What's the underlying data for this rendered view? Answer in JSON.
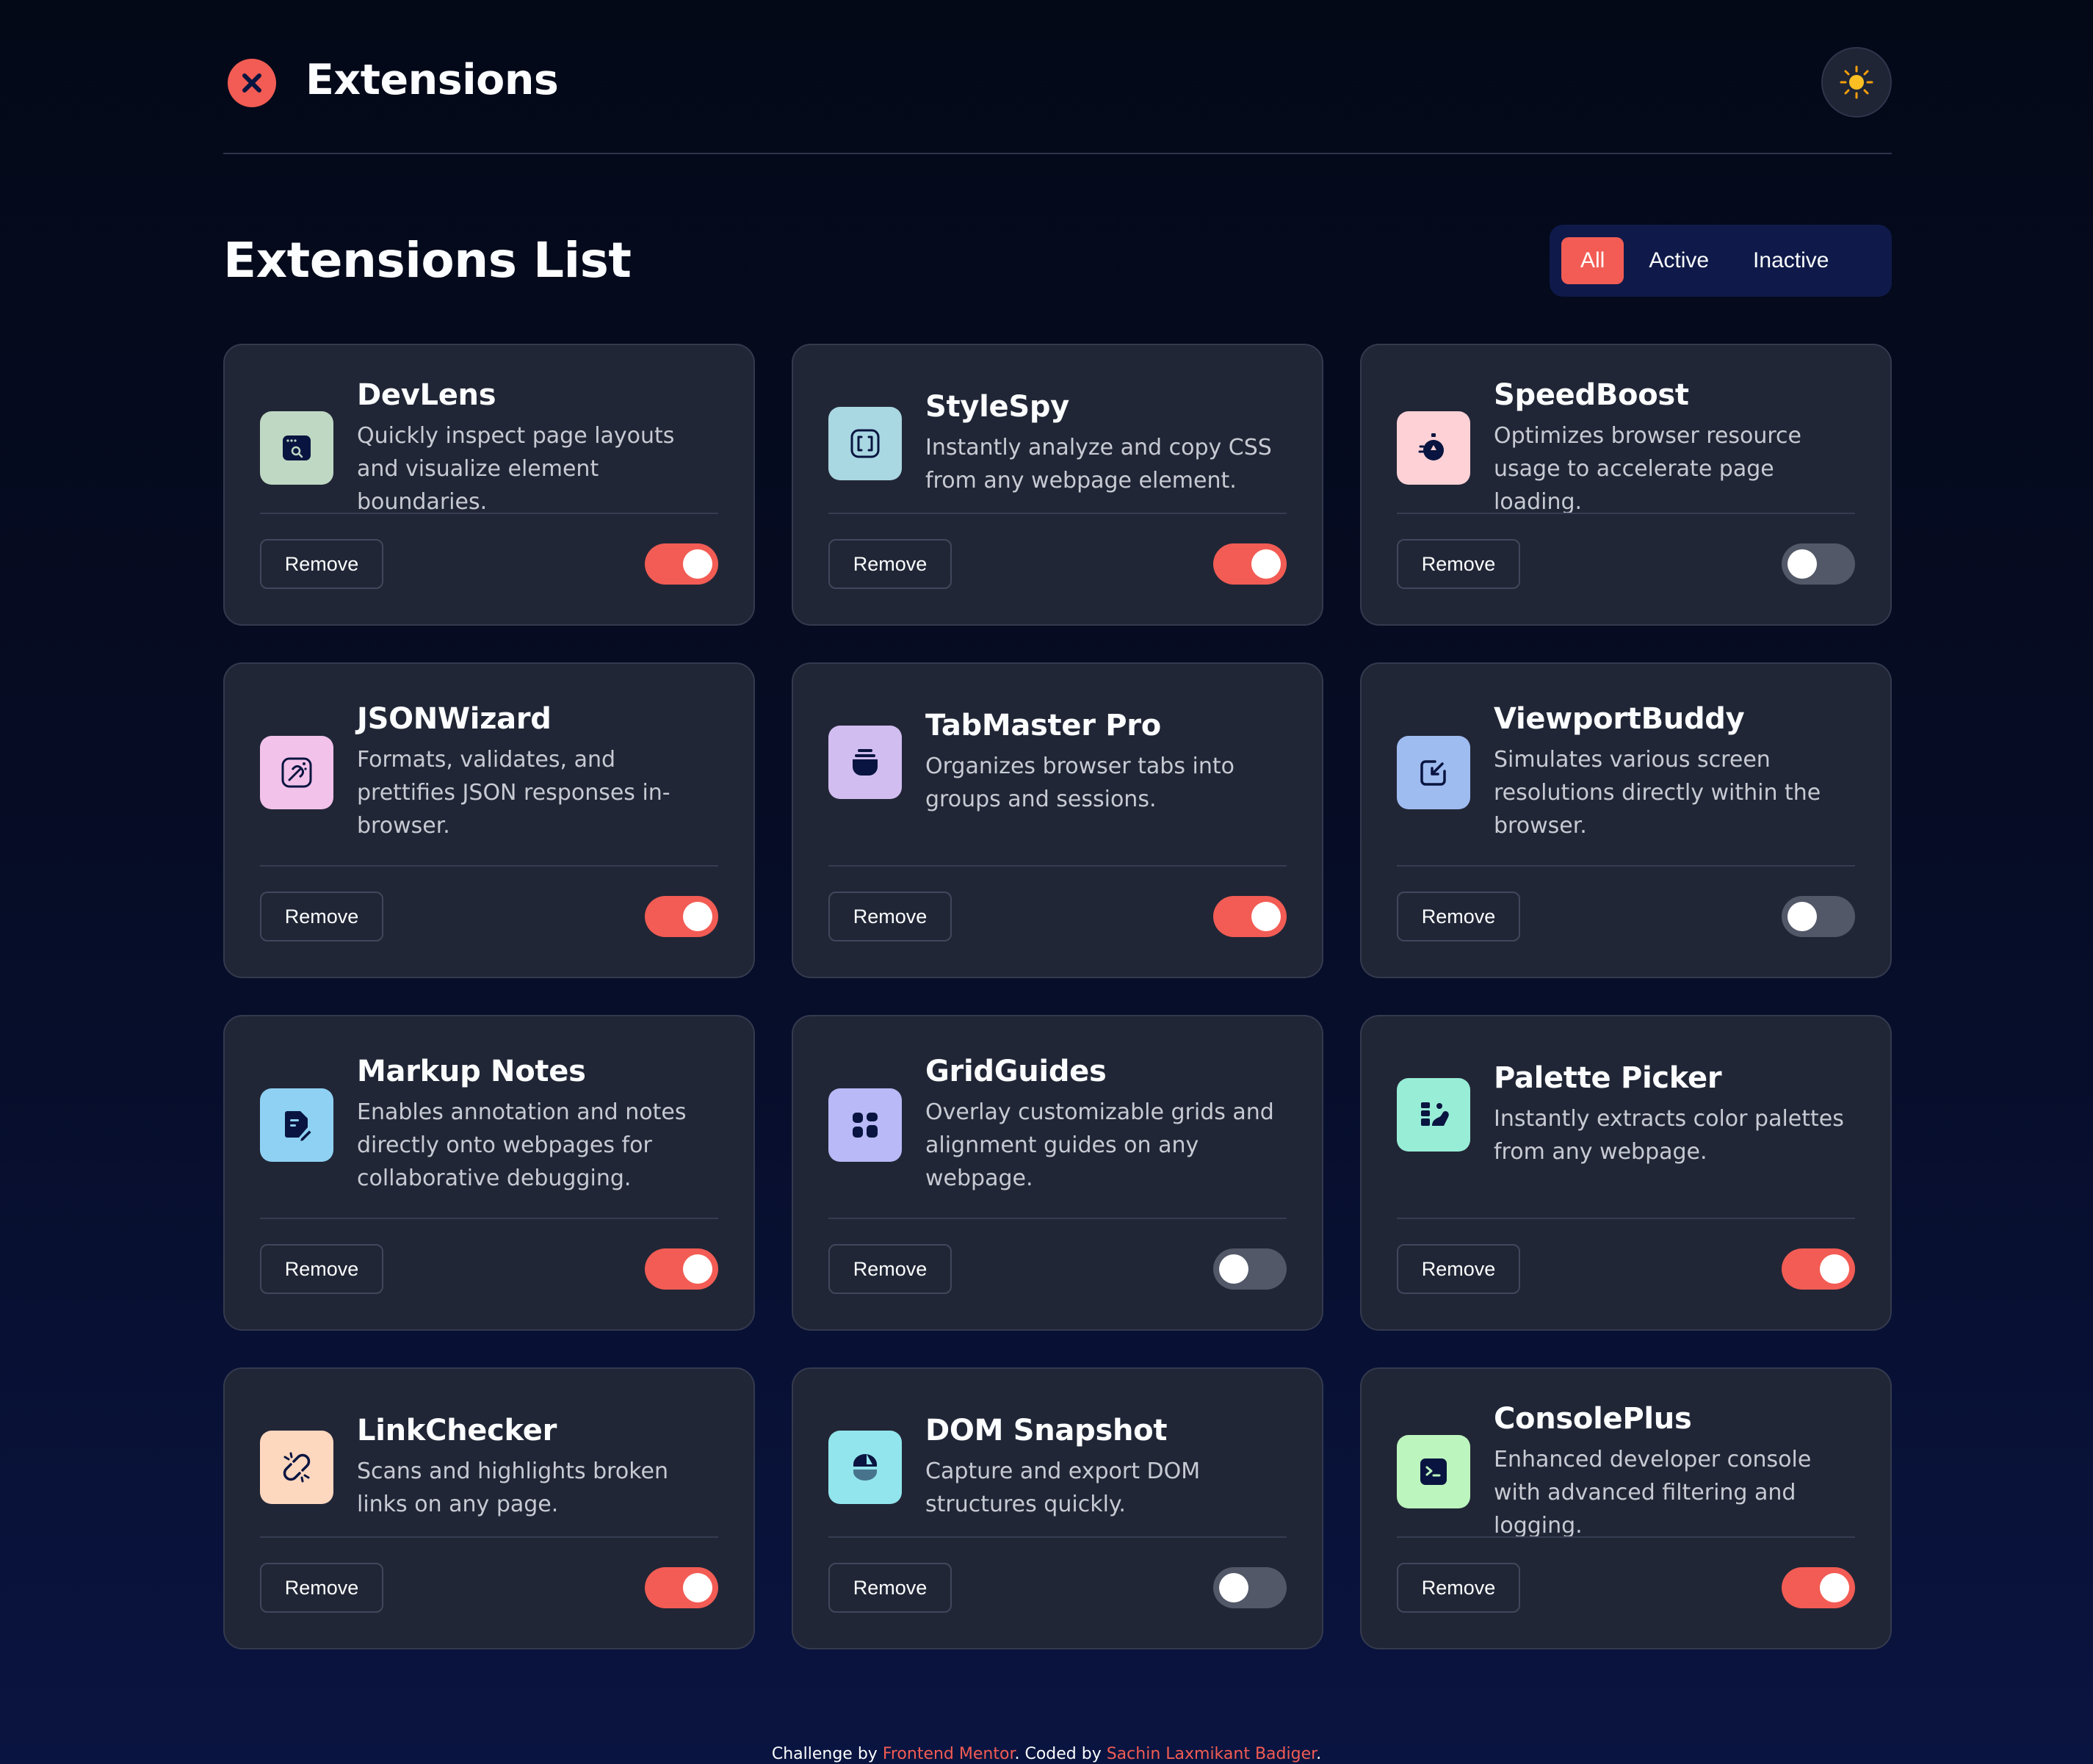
{
  "header": {
    "brand": "Extensions",
    "theme_toggle_icon": "sun-icon"
  },
  "main": {
    "title": "Extensions List",
    "filters": [
      {
        "label": "All",
        "selected": true
      },
      {
        "label": "Active",
        "selected": false
      },
      {
        "label": "Inactive",
        "selected": false
      }
    ]
  },
  "extensions": [
    {
      "name": "DevLens",
      "description": "Quickly inspect page layouts and visualize element boundaries.",
      "remove_label": "Remove",
      "enabled": true,
      "icon": "browser-search-icon",
      "icon_bg": "#bfd8c3"
    },
    {
      "name": "StyleSpy",
      "description": "Instantly analyze and copy CSS from any webpage element.",
      "remove_label": "Remove",
      "enabled": true,
      "icon": "code-brackets-icon",
      "icon_bg": "#a9d7e2"
    },
    {
      "name": "SpeedBoost",
      "description": "Optimizes browser resource usage to accelerate page loading.",
      "remove_label": "Remove",
      "enabled": false,
      "icon": "stopwatch-icon",
      "icon_bg": "#fdd1d5"
    },
    {
      "name": "JSONWizard",
      "description": "Formats, validates, and prettifies JSON responses in-browser.",
      "remove_label": "Remove",
      "enabled": true,
      "icon": "magic-wand-icon",
      "icon_bg": "#f2c2ea"
    },
    {
      "name": "TabMaster Pro",
      "description": "Organizes browser tabs into groups and sessions.",
      "remove_label": "Remove",
      "enabled": true,
      "icon": "tabs-stack-icon",
      "icon_bg": "#d2bdf0"
    },
    {
      "name": "ViewportBuddy",
      "description": "Simulates various screen resolutions directly within the browser.",
      "remove_label": "Remove",
      "enabled": false,
      "icon": "resize-arrow-icon",
      "icon_bg": "#9fbcf1"
    },
    {
      "name": "Markup Notes",
      "description": "Enables annotation and notes directly onto webpages for collaborative debugging.",
      "remove_label": "Remove",
      "enabled": true,
      "icon": "note-pen-icon",
      "icon_bg": "#8fd1f3"
    },
    {
      "name": "GridGuides",
      "description": "Overlay customizable grids and alignment guides on any webpage.",
      "remove_label": "Remove",
      "enabled": false,
      "icon": "grid-layout-icon",
      "icon_bg": "#b8b9f6"
    },
    {
      "name": "Palette Picker",
      "description": "Instantly extracts color palettes from any webpage.",
      "remove_label": "Remove",
      "enabled": true,
      "icon": "palette-icon",
      "icon_bg": "#98edd7"
    },
    {
      "name": "LinkChecker",
      "description": "Scans and highlights broken links on any page.",
      "remove_label": "Remove",
      "enabled": true,
      "icon": "broken-link-icon",
      "icon_bg": "#fed7bf"
    },
    {
      "name": "DOM Snapshot",
      "description": "Capture and export DOM structures quickly.",
      "remove_label": "Remove",
      "enabled": false,
      "icon": "camera-snapshot-icon",
      "icon_bg": "#92e5ec"
    },
    {
      "name": "ConsolePlus",
      "description": "Enhanced developer console with advanced filtering and logging.",
      "remove_label": "Remove",
      "enabled": true,
      "icon": "terminal-icon",
      "icon_bg": "#bdf5be"
    }
  ],
  "footer": {
    "prefix": "Challenge by ",
    "link1": "Frontend Mentor",
    "middle": ". Coded by ",
    "link2": "Sachin Laxmikant Badiger",
    "suffix": "."
  },
  "colors": {
    "accent": "#f25c54",
    "card": "#212636",
    "toggle_off": "#525868"
  }
}
